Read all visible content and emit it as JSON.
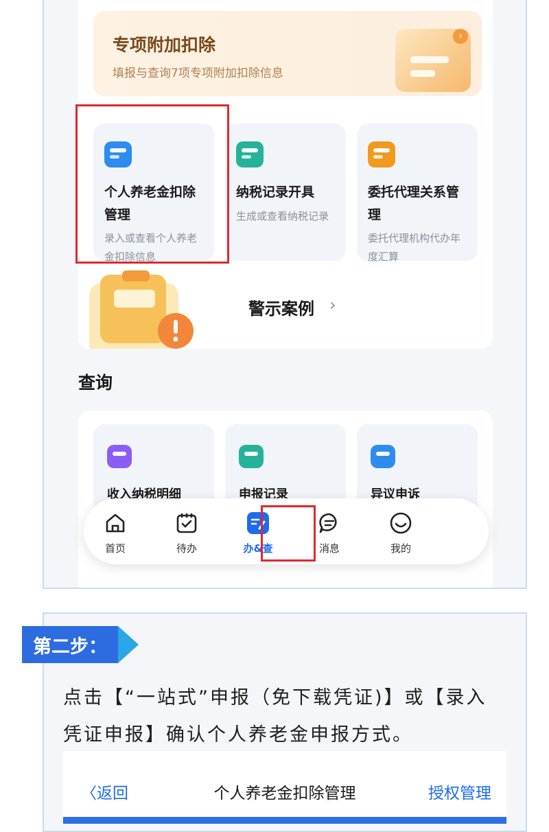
{
  "deduction_banner": {
    "title": "专项附加扣除",
    "subtitle": "填报与查询7项专项附加扣除信息"
  },
  "service_tiles": [
    {
      "title": "个人养老金扣除管理",
      "desc": "录入或查看个人养老金扣除信息",
      "icon": "pension-card-icon",
      "color": "#2d8cf0"
    },
    {
      "title": "纳税记录开具",
      "desc": "生成或查看纳税记录",
      "icon": "tax-record-icon",
      "color": "#24b29b"
    },
    {
      "title": "委托代理关系管理",
      "desc": "委托代理机构代办年度汇算",
      "icon": "agency-icon",
      "color": "#f29a1e"
    }
  ],
  "warning_case": {
    "label": "警示案例",
    "chevron": "›"
  },
  "query_section": {
    "title": "查询",
    "tiles": [
      {
        "title": "收入纳税明细",
        "icon": "income-detail-icon",
        "color": "#8b5cf6"
      },
      {
        "title": "申报记录",
        "icon": "declaration-record-icon",
        "color": "#24b29b"
      },
      {
        "title": "异议申诉",
        "icon": "appeal-icon",
        "color": "#2d8cf0"
      }
    ]
  },
  "tabbar": {
    "items": [
      {
        "label": "首页",
        "icon": "home-icon"
      },
      {
        "label": "待办",
        "icon": "calendar-check-icon"
      },
      {
        "label": "办&查",
        "icon": "edit-search-icon",
        "active": true
      },
      {
        "label": "消息",
        "icon": "message-icon"
      },
      {
        "label": "我的",
        "icon": "smile-icon"
      }
    ]
  },
  "step2": {
    "badge": "第二步：",
    "description": "点击【“一站式”申报（免下载凭证)】或【录入凭证申报】确认个人养老金申报方式。"
  },
  "second_screen": {
    "back_label": "〈返回",
    "title": "个人养老金扣除管理",
    "right_action": "授权管理"
  },
  "colors": {
    "accent": "#1e6bf0",
    "highlight": "#e0282e",
    "badge": "#2d6ce0"
  }
}
